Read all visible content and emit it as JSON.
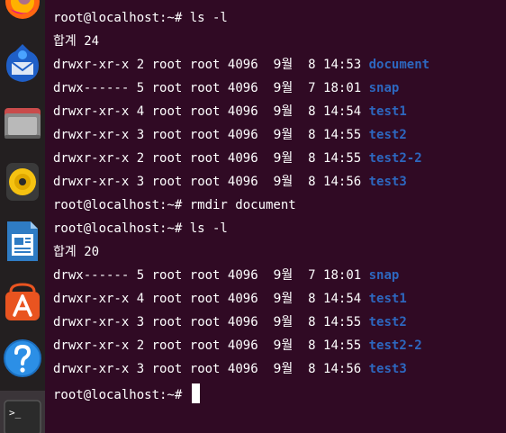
{
  "dock": {
    "items": [
      {
        "name": "firefox-icon"
      },
      {
        "name": "thunderbird-icon"
      },
      {
        "name": "files-icon"
      },
      {
        "name": "rhythmbox-icon"
      },
      {
        "name": "libreoffice-writer-icon"
      },
      {
        "name": "software-center-icon"
      },
      {
        "name": "help-icon"
      },
      {
        "name": "terminal-icon",
        "label": ">_"
      }
    ]
  },
  "terminal": {
    "colors": {
      "background": "#300a24",
      "text": "#ffffff",
      "directory": "#2d67bf"
    },
    "lines": [
      {
        "type": "prompt",
        "prompt": "root@localhost:~# ",
        "command": "ls -l"
      },
      {
        "type": "total",
        "label": "합계",
        "value": "24"
      },
      {
        "type": "entry",
        "perm": "drwxr-xr-x",
        "links": "2",
        "owner": "root",
        "group": "root",
        "size": "4096",
        "month": "9월",
        "day": "8",
        "time": "14:53",
        "name": "document"
      },
      {
        "type": "entry",
        "perm": "drwx------",
        "links": "5",
        "owner": "root",
        "group": "root",
        "size": "4096",
        "month": "9월",
        "day": "7",
        "time": "18:01",
        "name": "snap"
      },
      {
        "type": "entry",
        "perm": "drwxr-xr-x",
        "links": "4",
        "owner": "root",
        "group": "root",
        "size": "4096",
        "month": "9월",
        "day": "8",
        "time": "14:54",
        "name": "test1"
      },
      {
        "type": "entry",
        "perm": "drwxr-xr-x",
        "links": "3",
        "owner": "root",
        "group": "root",
        "size": "4096",
        "month": "9월",
        "day": "8",
        "time": "14:55",
        "name": "test2"
      },
      {
        "type": "entry",
        "perm": "drwxr-xr-x",
        "links": "2",
        "owner": "root",
        "group": "root",
        "size": "4096",
        "month": "9월",
        "day": "8",
        "time": "14:55",
        "name": "test2-2"
      },
      {
        "type": "entry",
        "perm": "drwxr-xr-x",
        "links": "3",
        "owner": "root",
        "group": "root",
        "size": "4096",
        "month": "9월",
        "day": "8",
        "time": "14:56",
        "name": "test3"
      },
      {
        "type": "prompt",
        "prompt": "root@localhost:~# ",
        "command": "rmdir document"
      },
      {
        "type": "prompt",
        "prompt": "root@localhost:~# ",
        "command": "ls -l"
      },
      {
        "type": "total",
        "label": "합계",
        "value": "20"
      },
      {
        "type": "entry",
        "perm": "drwx------",
        "links": "5",
        "owner": "root",
        "group": "root",
        "size": "4096",
        "month": "9월",
        "day": "7",
        "time": "18:01",
        "name": "snap"
      },
      {
        "type": "entry",
        "perm": "drwxr-xr-x",
        "links": "4",
        "owner": "root",
        "group": "root",
        "size": "4096",
        "month": "9월",
        "day": "8",
        "time": "14:54",
        "name": "test1"
      },
      {
        "type": "entry",
        "perm": "drwxr-xr-x",
        "links": "3",
        "owner": "root",
        "group": "root",
        "size": "4096",
        "month": "9월",
        "day": "8",
        "time": "14:55",
        "name": "test2"
      },
      {
        "type": "entry",
        "perm": "drwxr-xr-x",
        "links": "2",
        "owner": "root",
        "group": "root",
        "size": "4096",
        "month": "9월",
        "day": "8",
        "time": "14:55",
        "name": "test2-2"
      },
      {
        "type": "entry",
        "perm": "drwxr-xr-x",
        "links": "3",
        "owner": "root",
        "group": "root",
        "size": "4096",
        "month": "9월",
        "day": "8",
        "time": "14:56",
        "name": "test3"
      },
      {
        "type": "prompt",
        "prompt": "root@localhost:~# ",
        "command": "",
        "cursor": true
      }
    ]
  }
}
